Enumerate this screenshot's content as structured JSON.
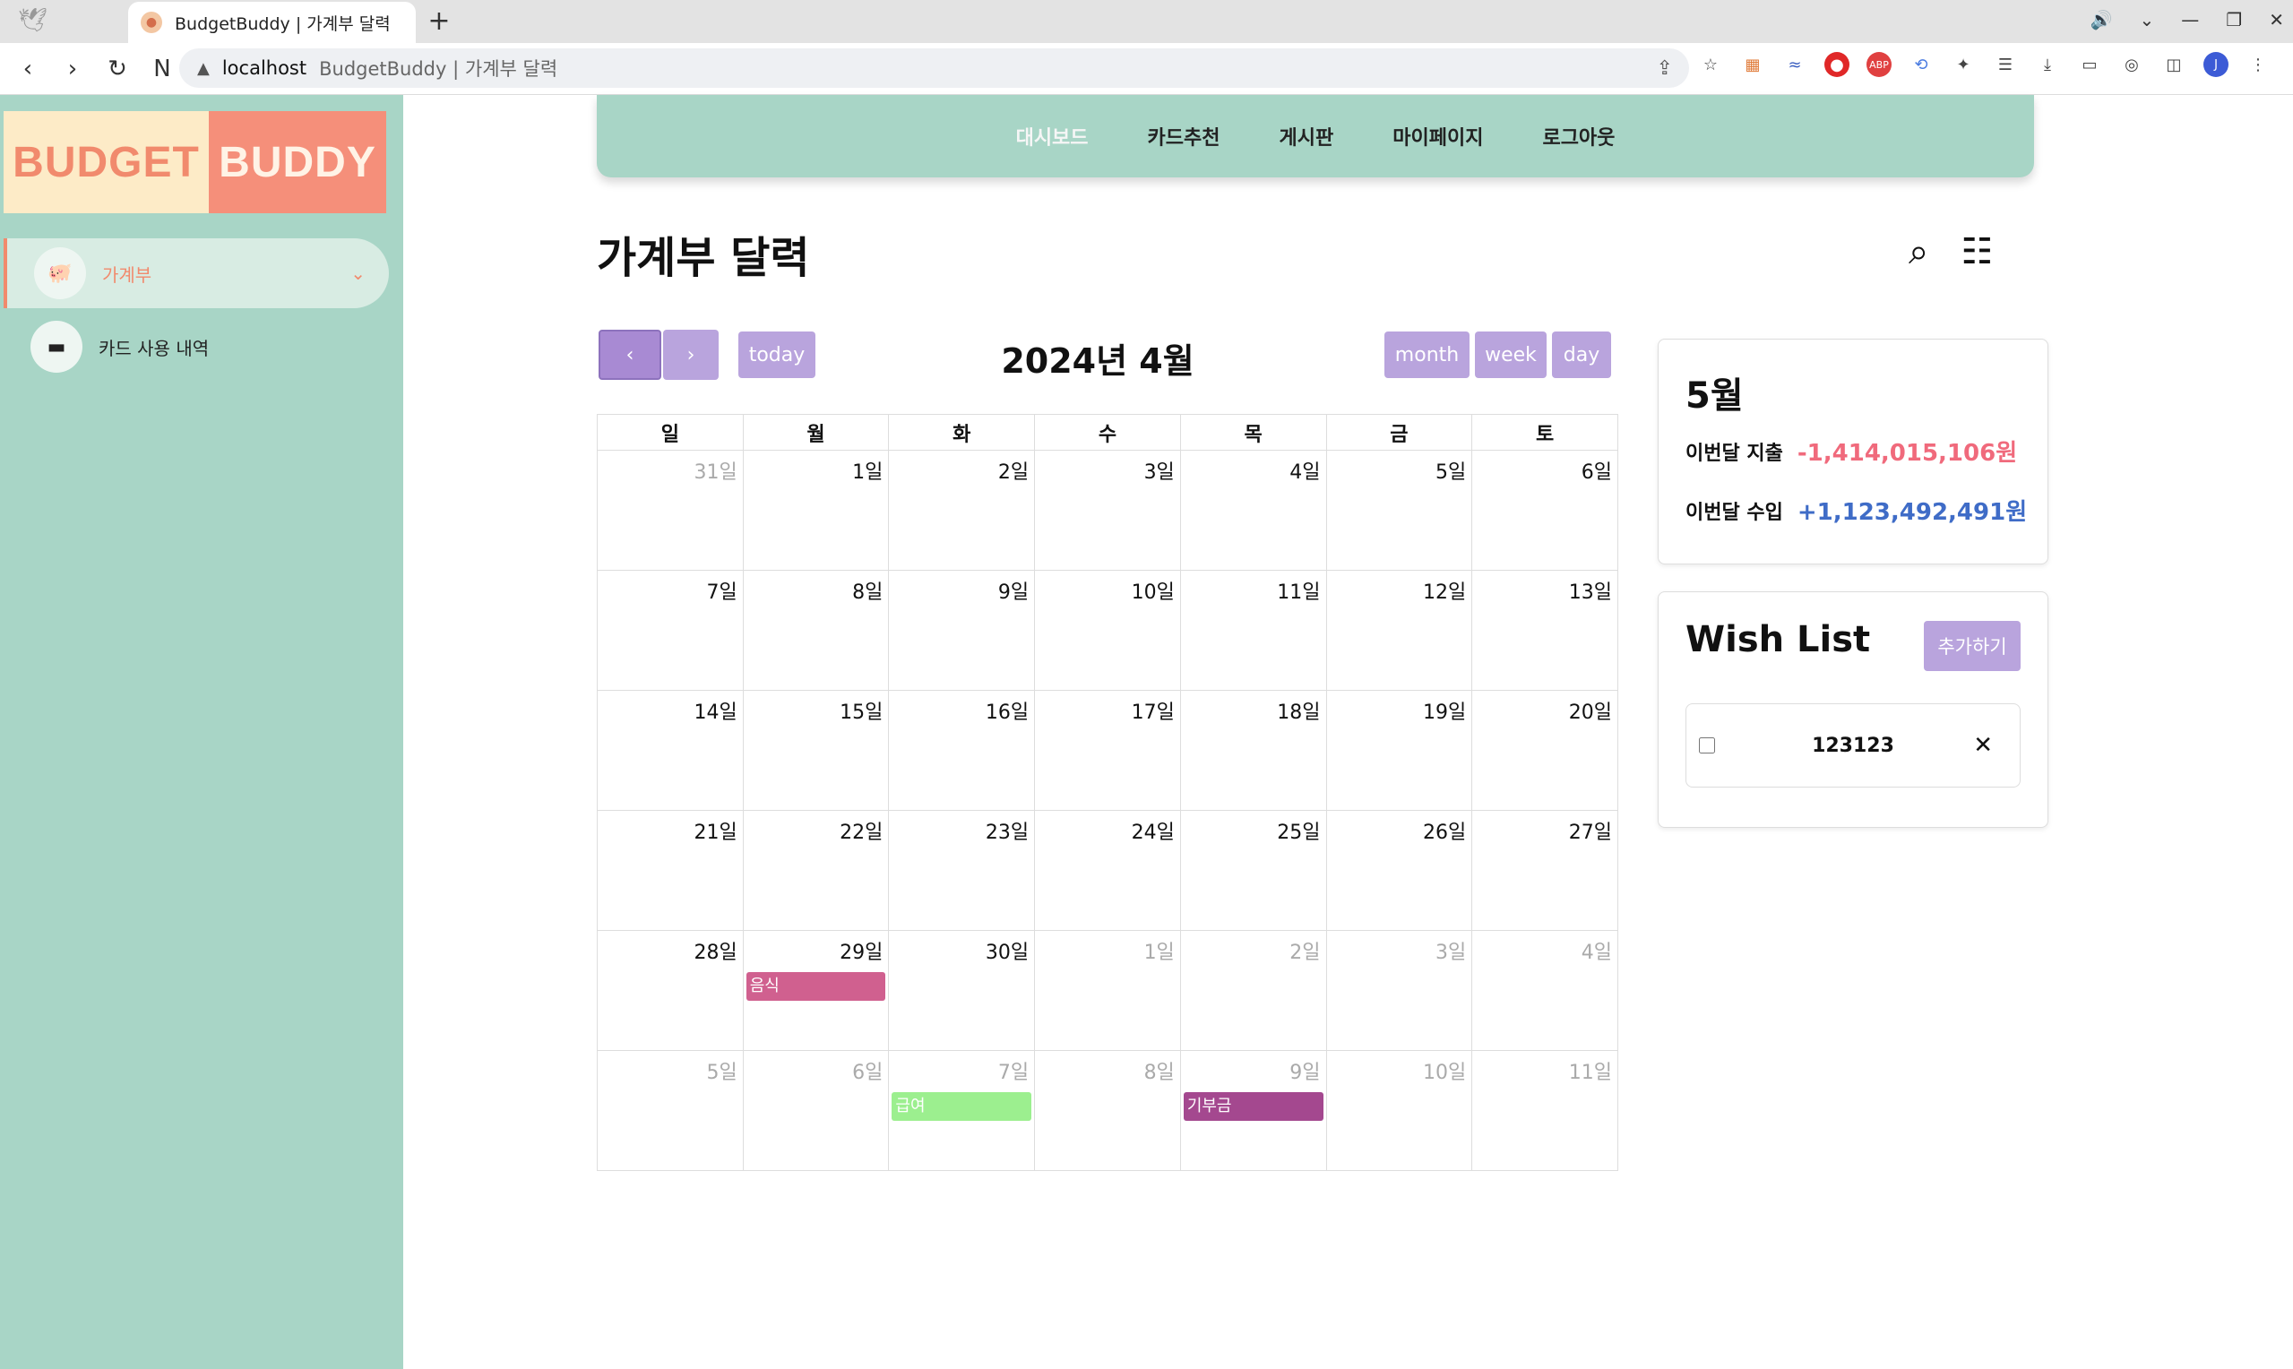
{
  "browser": {
    "tab_title": "BudgetBuddy | 가계부 달력",
    "new_tab": "+",
    "url_host": "localhost",
    "url_path": "BudgetBuddy | 가계부 달력"
  },
  "logo": {
    "part1": "BUDGET",
    "part2": "BUDDY"
  },
  "sidebar": {
    "items": [
      {
        "label": "가계부",
        "icon": "piggy-bank-icon",
        "active": true
      },
      {
        "label": "카드 사용 내역",
        "icon": "credit-card-icon",
        "active": false
      }
    ]
  },
  "topnav": {
    "items": [
      "대시보드",
      "카드추천",
      "게시판",
      "마이페이지",
      "로그아웃"
    ]
  },
  "page": {
    "title": "가계부 달력"
  },
  "calendar": {
    "title": "2024년 4월",
    "prev": "‹",
    "next": "›",
    "today": "today",
    "views": [
      "month",
      "week",
      "day"
    ],
    "weekdays": [
      "일",
      "월",
      "화",
      "수",
      "목",
      "금",
      "토"
    ],
    "weeks": [
      [
        {
          "d": "31일",
          "other": true
        },
        {
          "d": "1일"
        },
        {
          "d": "2일"
        },
        {
          "d": "3일"
        },
        {
          "d": "4일"
        },
        {
          "d": "5일"
        },
        {
          "d": "6일"
        }
      ],
      [
        {
          "d": "7일"
        },
        {
          "d": "8일"
        },
        {
          "d": "9일"
        },
        {
          "d": "10일"
        },
        {
          "d": "11일"
        },
        {
          "d": "12일"
        },
        {
          "d": "13일"
        }
      ],
      [
        {
          "d": "14일"
        },
        {
          "d": "15일"
        },
        {
          "d": "16일"
        },
        {
          "d": "17일"
        },
        {
          "d": "18일"
        },
        {
          "d": "19일"
        },
        {
          "d": "20일"
        }
      ],
      [
        {
          "d": "21일"
        },
        {
          "d": "22일"
        },
        {
          "d": "23일"
        },
        {
          "d": "24일"
        },
        {
          "d": "25일"
        },
        {
          "d": "26일"
        },
        {
          "d": "27일"
        }
      ],
      [
        {
          "d": "28일"
        },
        {
          "d": "29일",
          "event": {
            "label": "음식",
            "color": "#d0608f"
          }
        },
        {
          "d": "30일"
        },
        {
          "d": "1일",
          "other": true
        },
        {
          "d": "2일",
          "other": true
        },
        {
          "d": "3일",
          "other": true
        },
        {
          "d": "4일",
          "other": true
        }
      ],
      [
        {
          "d": "5일",
          "other": true
        },
        {
          "d": "6일",
          "other": true
        },
        {
          "d": "7일",
          "other": true,
          "event": {
            "label": "급여",
            "color": "#9cef8f"
          }
        },
        {
          "d": "8일",
          "other": true
        },
        {
          "d": "9일",
          "other": true,
          "event": {
            "label": "기부금",
            "color": "#a4488f"
          }
        },
        {
          "d": "10일",
          "other": true
        },
        {
          "d": "11일",
          "other": true
        }
      ]
    ]
  },
  "month_summary": {
    "month": "5월",
    "expense_label": "이번달 지출",
    "expense_value": "-1,414,015,106원",
    "expense_color": "#f06a7c",
    "income_label": "이번달 수입",
    "income_value": "+1,123,492,491원",
    "income_color": "#3f6cc7"
  },
  "wishlist": {
    "title": "Wish List",
    "add_label": "추가하기",
    "items": [
      {
        "text": "123123",
        "checked": false
      }
    ],
    "remove": "✕"
  },
  "colors": {
    "sidebar": "#a8d5c6",
    "accent_purple": "#b9a4dd",
    "logo_orange": "#f58f7a",
    "logo_cream": "#fdebc7"
  }
}
